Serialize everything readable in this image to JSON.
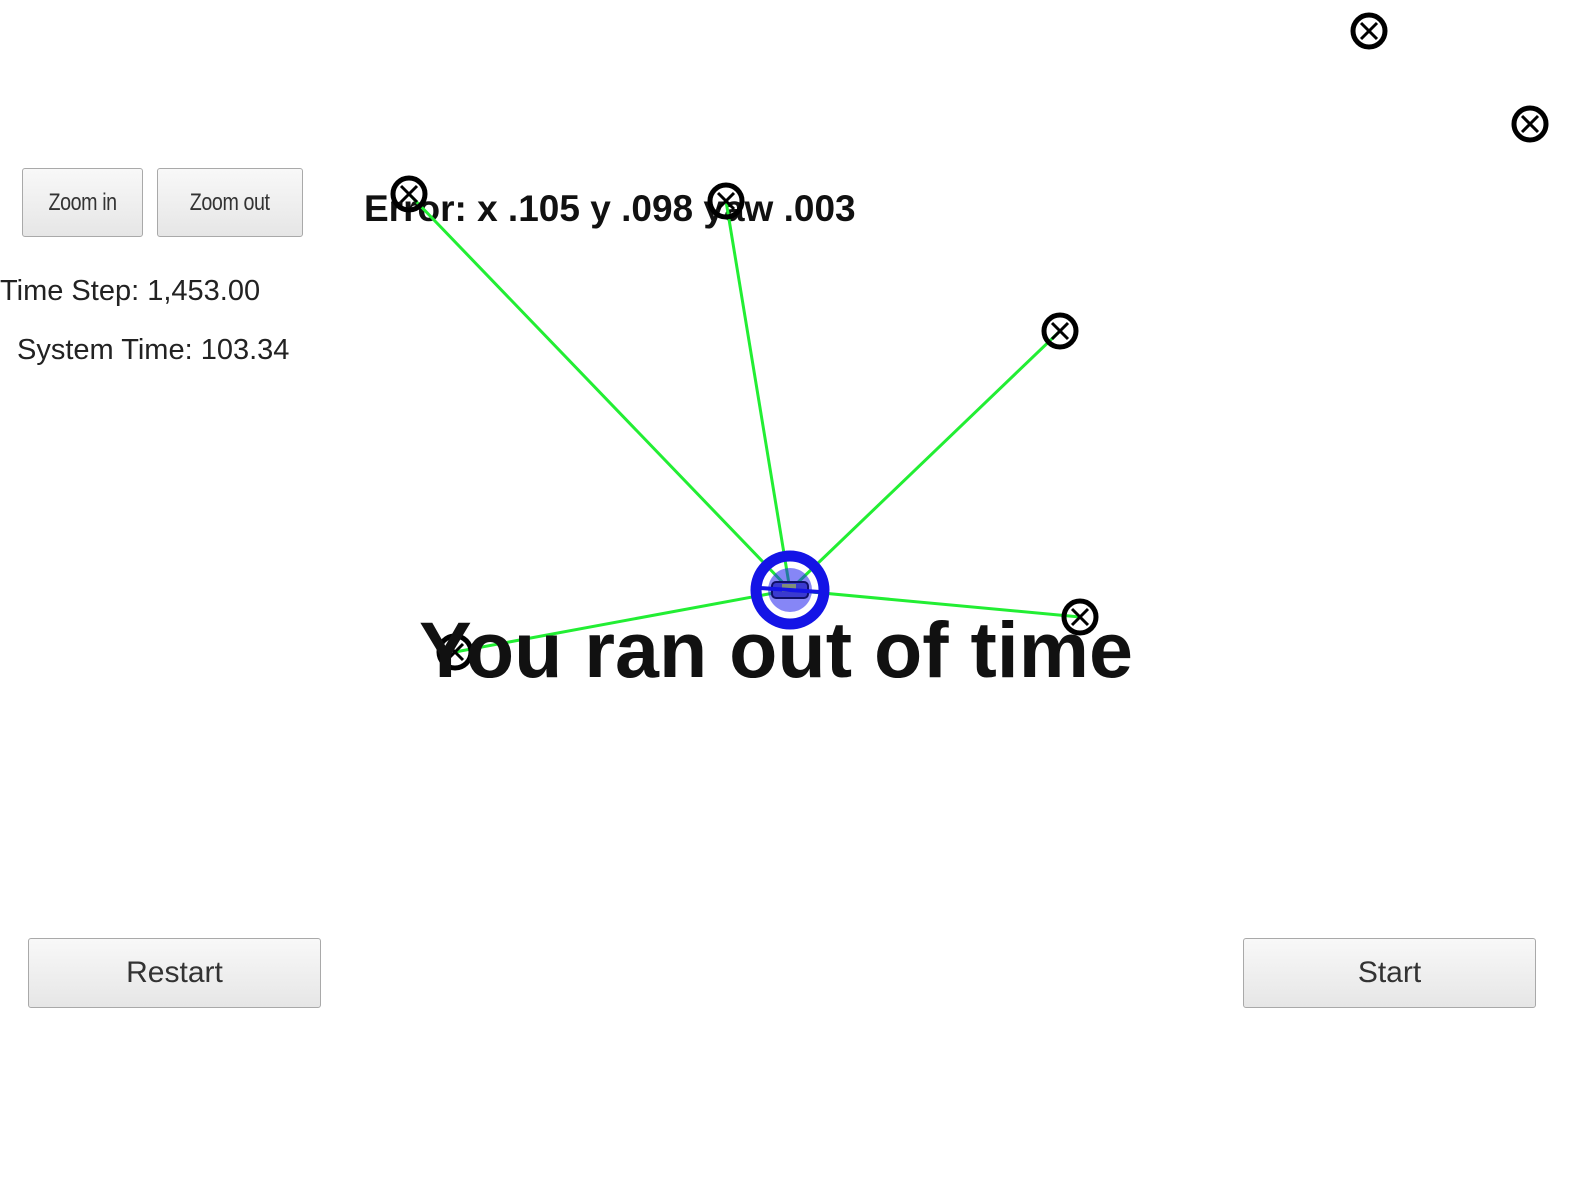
{
  "controls": {
    "zoom_in_label": "Zoom in",
    "zoom_out_label": "Zoom out",
    "restart_label": "Restart",
    "start_label": "Start"
  },
  "stats": {
    "time_step": "Time Step: 1,453.00",
    "system_time": "System Time: 103.34"
  },
  "overlay": {
    "error_text": "Error: x .105 y .098 yaw .003",
    "status_text": "You ran out of time"
  },
  "colors": {
    "observation_line": "#22ee33",
    "vehicle": "#1414e6",
    "landmark": "#000000"
  },
  "icons": {
    "landmark": "circled-x-landmark-icon",
    "vehicle": "car-icon"
  }
}
